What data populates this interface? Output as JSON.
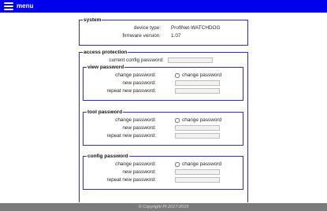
{
  "header": {
    "menu_label": "menu"
  },
  "system": {
    "legend": "system",
    "device_type_label": "device type:",
    "device_type_value": "ProfiNet-WATCHDOG",
    "firmware_label": "firmware version:",
    "firmware_value": "1.07"
  },
  "access": {
    "legend": "access protection",
    "current_label": "current config password:",
    "sections": [
      {
        "legend": "view password",
        "change_label": "change password:",
        "checkbox_label": "change password",
        "new_label": "new password:",
        "repeat_label": "repeat new password:"
      },
      {
        "legend": "tool password",
        "change_label": "change password:",
        "checkbox_label": "change password",
        "new_label": "new password:",
        "repeat_label": "repeat new password:"
      },
      {
        "legend": "config password",
        "change_label": "change password:",
        "checkbox_label": "change password",
        "new_label": "new password:",
        "repeat_label": "repeat new password:"
      }
    ]
  },
  "footer": {
    "copyright": "© Copyright PI 2017-2019"
  },
  "colors": {
    "header_bg": "#0000ee",
    "border": "#2a2ad6",
    "footer_bg": "#7b7b7b"
  }
}
